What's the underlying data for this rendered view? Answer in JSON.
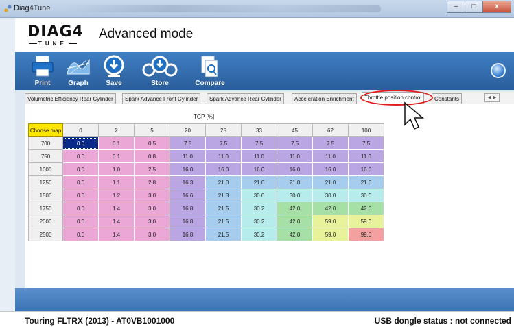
{
  "window": {
    "title": "Diag4Tune"
  },
  "header": {
    "logo_main": "DIAG4",
    "logo_sub": "TUNE",
    "mode": "Advanced mode"
  },
  "toolbar": {
    "print": "Print",
    "graph": "Graph",
    "save": "Save",
    "store": "Store",
    "compare": "Compare"
  },
  "tabs": [
    "Volumetric Efficiency Rear Cylinder",
    "Spark Advance Front Cylinder",
    "Spark Advance Rear Cylinder",
    "Acceleration Enrichment",
    "Throttle position control",
    "Constants"
  ],
  "active_tab": "Throttle position control",
  "map": {
    "axis_label": "TGP [%]",
    "choose_label": "Choose map",
    "columns": [
      "0",
      "2",
      "5",
      "20",
      "25",
      "33",
      "45",
      "62",
      "100"
    ],
    "rows": [
      {
        "label": "700",
        "values": [
          "0.0",
          "0.1",
          "0.5",
          "7.5",
          "7.5",
          "7.5",
          "7.5",
          "7.5",
          "7.5"
        ]
      },
      {
        "label": "750",
        "values": [
          "0.0",
          "0.1",
          "0.8",
          "11.0",
          "11.0",
          "11.0",
          "11.0",
          "11.0",
          "11.0"
        ]
      },
      {
        "label": "1000",
        "values": [
          "0.0",
          "1.0",
          "2.5",
          "16.0",
          "16.0",
          "16.0",
          "16.0",
          "16.0",
          "16.0"
        ]
      },
      {
        "label": "1250",
        "values": [
          "0.0",
          "1.1",
          "2.8",
          "16.3",
          "21.0",
          "21.0",
          "21.0",
          "21.0",
          "21.0"
        ]
      },
      {
        "label": "1500",
        "values": [
          "0.0",
          "1.2",
          "3.0",
          "16.6",
          "21.3",
          "30.0",
          "30.0",
          "30.0",
          "30.0"
        ]
      },
      {
        "label": "1750",
        "values": [
          "0.0",
          "1.4",
          "3.0",
          "16.8",
          "21.5",
          "30.2",
          "42.0",
          "42.0",
          "42.0"
        ]
      },
      {
        "label": "2000",
        "values": [
          "0.0",
          "1.4",
          "3.0",
          "16.8",
          "21.5",
          "30.2",
          "42.0",
          "59.0",
          "59.0"
        ]
      },
      {
        "label": "2500",
        "values": [
          "0.0",
          "1.4",
          "3.0",
          "16.8",
          "21.5",
          "30.2",
          "42.0",
          "59.0",
          "99.0"
        ]
      }
    ],
    "colors": {
      "pink": "#eba8d6",
      "purple": "#b9a6e3",
      "lightblue": "#a6cdee",
      "cyan": "#b6ecec",
      "green": "#a6e0a6",
      "yellow": "#e8f29a",
      "red": "#f2a0a0"
    }
  },
  "status": {
    "vehicle": "Touring FLTRX (2013) - AT0VB1001000",
    "dongle": "USB dongle status : not connected"
  }
}
